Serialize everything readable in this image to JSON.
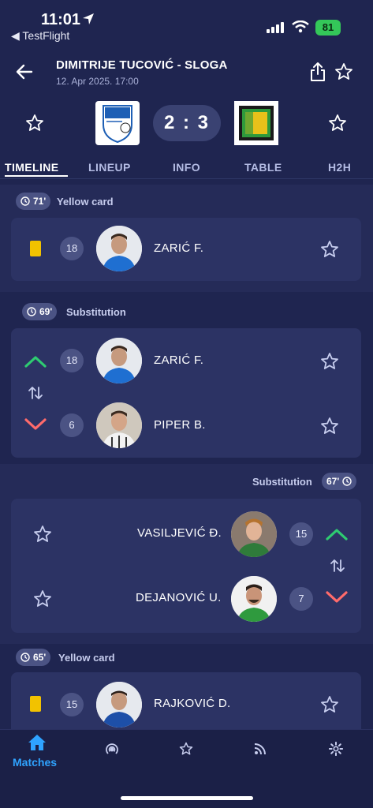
{
  "status_bar": {
    "time": "11:01",
    "back_app": "◀ TestFlight",
    "battery": "81"
  },
  "header": {
    "title": "DIMITRIJE TUCOVIĆ - SLOGA",
    "date": "12. Apr 2025. 17:00"
  },
  "match": {
    "score": "2 : 3"
  },
  "tabs": [
    "TIMELINE",
    "LINEUP",
    "INFO",
    "TABLE",
    "H2H"
  ],
  "events": [
    {
      "minute": "71'",
      "type": "Yellow card",
      "players": [
        {
          "number": "18",
          "name": "ZARIĆ F."
        }
      ]
    },
    {
      "minute": "69'",
      "type": "Substitution",
      "players": [
        {
          "number": "18",
          "name": "ZARIĆ F."
        },
        {
          "number": "6",
          "name": "PIPER B."
        }
      ]
    },
    {
      "minute": "67'",
      "type": "Substitution",
      "players": [
        {
          "number": "15",
          "name": "VASILJEVIĆ Đ."
        },
        {
          "number": "7",
          "name": "DEJANOVIĆ U."
        }
      ]
    },
    {
      "minute": "65'",
      "type": "Yellow card",
      "players": [
        {
          "number": "15",
          "name": "RAJKOVIĆ D."
        }
      ]
    }
  ],
  "bottom_nav": {
    "active_label": "Matches",
    "items": [
      "home-icon",
      "live-icon",
      "star-icon",
      "feed-icon",
      "settings-icon"
    ]
  },
  "colors": {
    "background": "#1f2550",
    "card": "#2c3364",
    "accent": "#2fa3ff",
    "sub_in": "#2ecc71",
    "sub_out": "#ff6b6b",
    "yellow_card": "#f2c200"
  }
}
